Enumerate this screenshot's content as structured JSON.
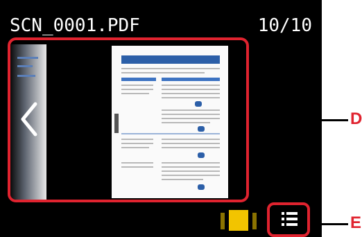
{
  "header": {
    "filename": "SCN_0001.PDF",
    "page_count": "10/10"
  },
  "preview": {
    "prev_button_icon": "chevron-left-icon"
  },
  "toolbar": {
    "view_mode_icon": "single-page-view-icon",
    "list_icon": "list-view-icon"
  },
  "callouts": {
    "d": "D",
    "e": "E"
  },
  "colors": {
    "highlight": "#e0232f",
    "background": "#000000",
    "view_mode_active": "#f2c400",
    "doc_accent": "#2c5fa8"
  }
}
